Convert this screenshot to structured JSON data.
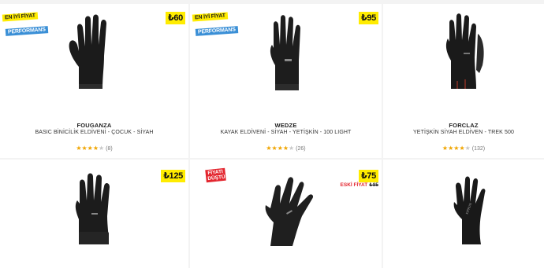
{
  "products": [
    {
      "price": "₺60",
      "badges": [
        "EN İYİ FİYAT",
        "PERFORMANS"
      ],
      "brand": "FOUGANZA",
      "title": "BASIC BİNİCİLİK ELDİVENİ - ÇOCUK - SİYAH",
      "rating": 4,
      "reviews": "(8)",
      "image": "black-riding-glove"
    },
    {
      "price": "₺95",
      "badges": [
        "EN İYİ FİYAT",
        "PERFORMANS"
      ],
      "brand": "WEDZE",
      "title": "KAYAK ELDİVENİ - SİYAH - YETİŞKİN - 100 LIGHT",
      "rating": 4,
      "reviews": "(26)",
      "image": "black-ski-glove"
    },
    {
      "price": "",
      "badges": [],
      "brand": "FORCLAZ",
      "title": "YETİŞKİN SİYAH ELDİVEN - TREK 500",
      "rating": 4,
      "reviews": "(132)",
      "image": "black-trek-glove"
    },
    {
      "price": "₺125",
      "badges": [],
      "image": "black-padded-glove"
    },
    {
      "price": "₺75",
      "old_price_label": "ESKİ FİYAT",
      "old_price": "₺85",
      "sale_badge": [
        "FİYATI",
        "DÜŞTÜ"
      ],
      "image": "black-running-glove"
    },
    {
      "price": "",
      "image": "black-touchscreen-glove"
    }
  ],
  "colors": {
    "price_bg": "#ffec00",
    "badge_blue": "#3a8fd6",
    "sale_red": "#e3262f",
    "star": "#f0a500"
  }
}
